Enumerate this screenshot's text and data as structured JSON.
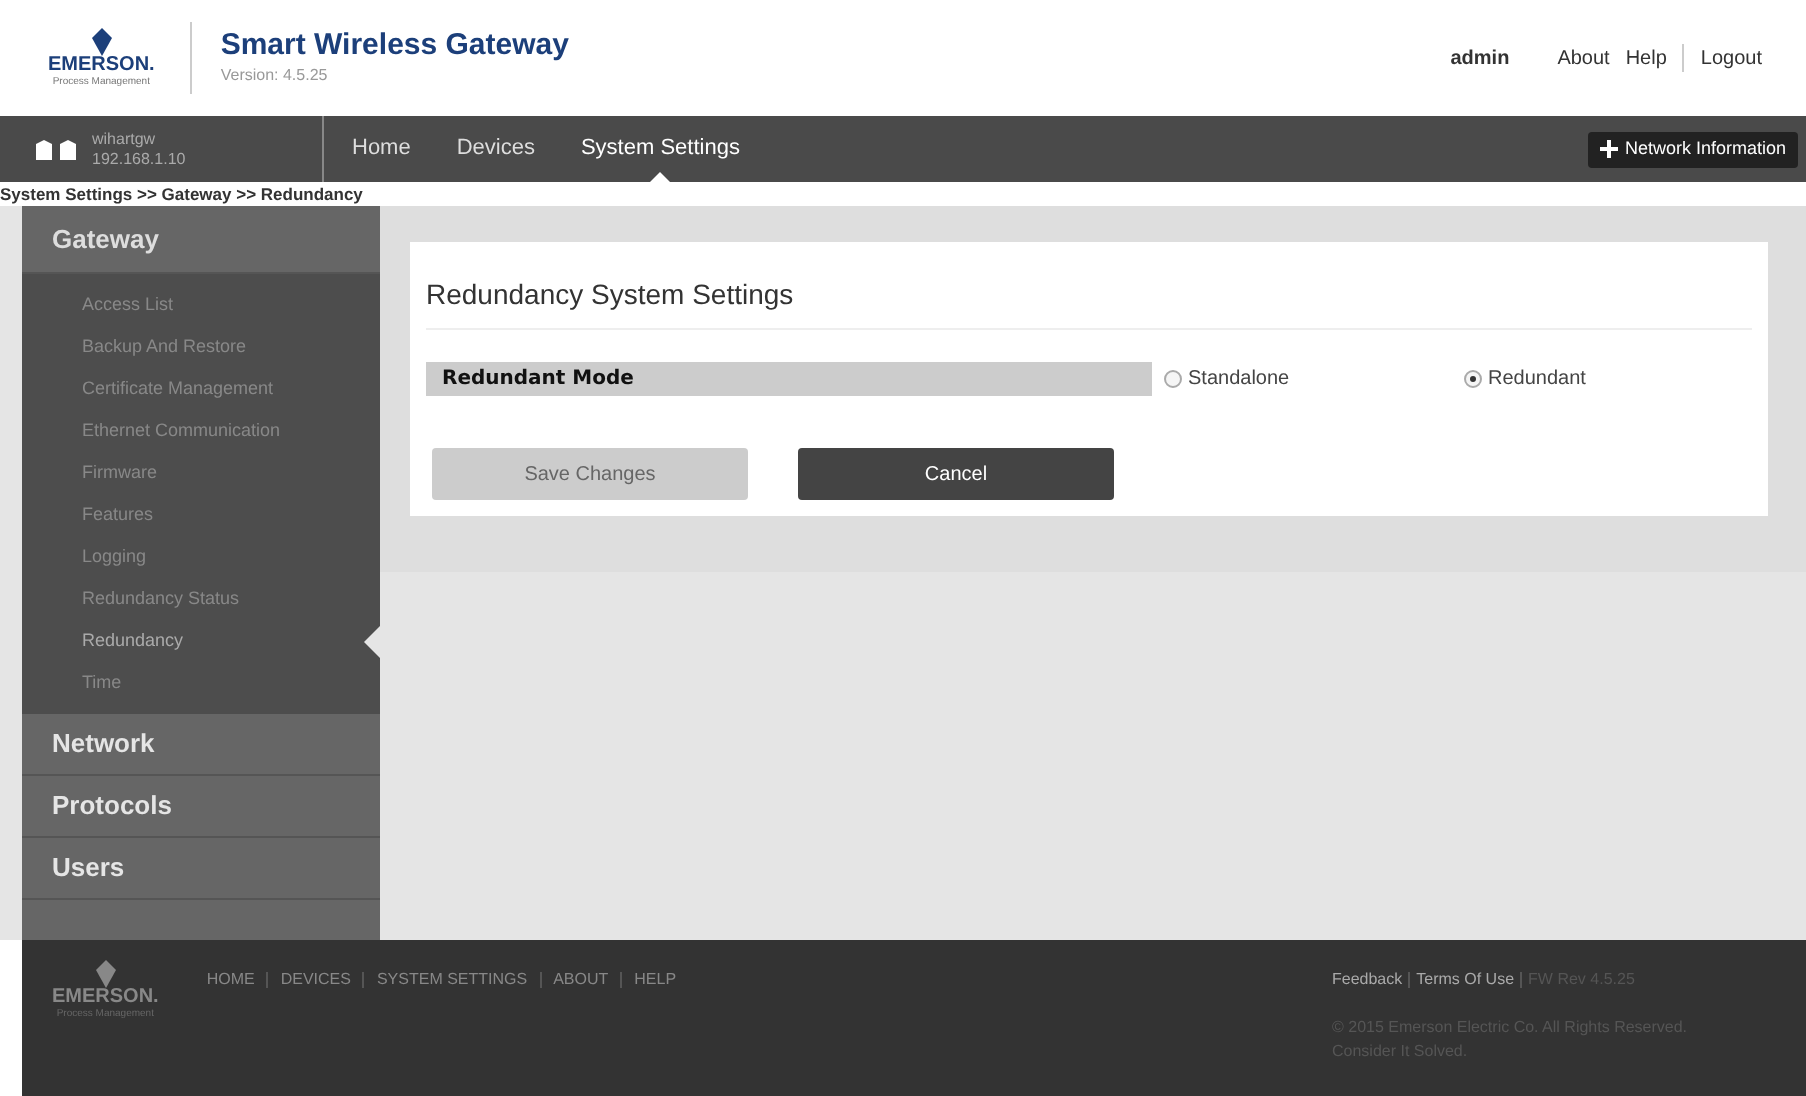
{
  "header": {
    "brand": "EMERSON.",
    "brand_sub": "Process Management",
    "title": "Smart Wireless Gateway",
    "version": "Version: 4.5.25",
    "user": "admin",
    "links": [
      "About",
      "Help",
      "Logout"
    ]
  },
  "navbar": {
    "hostname": "wihartgw",
    "ip": "192.168.1.10",
    "tabs": [
      {
        "label": "Home",
        "selected": false
      },
      {
        "label": "Devices",
        "selected": false
      },
      {
        "label": "System Settings",
        "selected": true
      }
    ],
    "network_button": "Network Information"
  },
  "breadcrumb": "System Settings >> Gateway >> Redundancy",
  "sidebar": {
    "sections": [
      {
        "label": "Gateway",
        "expanded": true,
        "children": [
          {
            "label": "Access List",
            "selected": false
          },
          {
            "label": "Backup And Restore",
            "selected": false
          },
          {
            "label": "Certificate Management",
            "selected": false
          },
          {
            "label": "Ethernet Communication",
            "selected": false
          },
          {
            "label": "Firmware",
            "selected": false
          },
          {
            "label": "Features",
            "selected": false
          },
          {
            "label": "Logging",
            "selected": false
          },
          {
            "label": "Redundancy Status",
            "selected": false
          },
          {
            "label": "Redundancy",
            "selected": true
          },
          {
            "label": "Time",
            "selected": false
          }
        ]
      },
      {
        "label": "Network",
        "expanded": false
      },
      {
        "label": "Protocols",
        "expanded": false
      },
      {
        "label": "Users",
        "expanded": false
      }
    ]
  },
  "panel": {
    "title": "Redundancy System Settings",
    "setting_label": "Redundant Mode",
    "options": [
      {
        "label": "Standalone",
        "selected": false
      },
      {
        "label": "Redundant",
        "selected": true
      }
    ],
    "buttons": [
      {
        "label": "Save Changes",
        "disabled": true
      },
      {
        "label": "Cancel",
        "disabled": false
      }
    ]
  },
  "footer": {
    "brand": "EMERSON.",
    "brand_sub": "Process Management",
    "links": [
      "HOME",
      "DEVICES",
      "SYSTEM SETTINGS",
      "ABOUT",
      "HELP"
    ],
    "feedback": "Feedback",
    "terms": "Terms Of Use",
    "fw": "FW Rev 4.5.25",
    "copyright": "© 2015 Emerson Electric Co. All Rights Reserved.",
    "slogan": "Consider It Solved."
  }
}
